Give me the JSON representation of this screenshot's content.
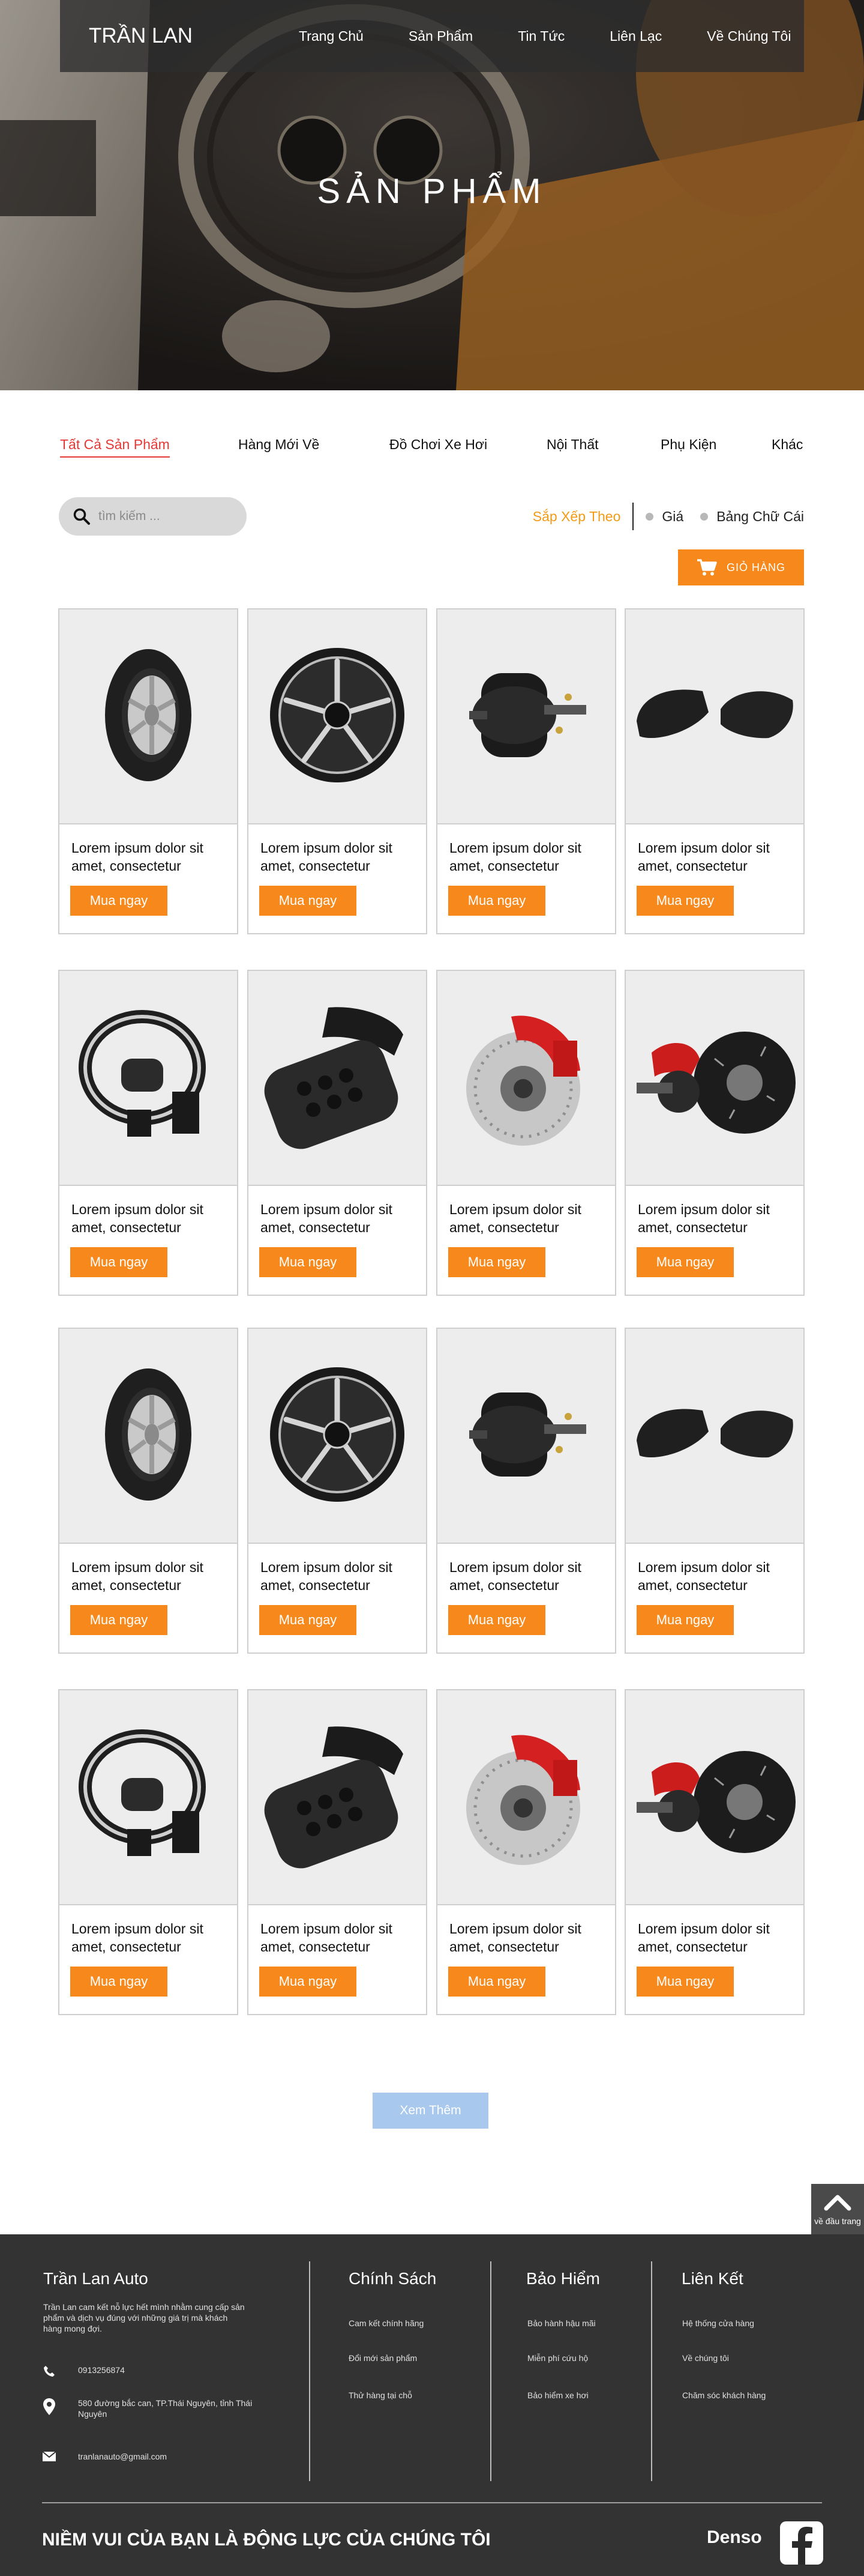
{
  "brand": "TRẦN LAN",
  "nav": [
    "Trang Chủ",
    "Sản Phẩm",
    "Tin Tức",
    "Liên Lạc",
    "Về Chúng Tôi"
  ],
  "hero_title": "SẢN PHẨM",
  "tabs": [
    "Tất Cả Sản Phẩm",
    "Hàng Mới Về",
    "Đồ Chơi Xe Hơi",
    "Nội Thất",
    "Phụ Kiện",
    "Khác"
  ],
  "search": {
    "placeholder": "tìm kiếm ..."
  },
  "sort": {
    "label": "Sắp Xếp Theo",
    "options": [
      "Giá",
      "Bảng Chữ Cái"
    ]
  },
  "cart_label": "GIỎ HÀNG",
  "buy_label": "Mua ngay",
  "product_title": "Lorem ipsum dolor sit amet, consectetur",
  "products": [
    {
      "icon": "tire-icon"
    },
    {
      "icon": "rim-icon"
    },
    {
      "icon": "brake-chamber-icon"
    },
    {
      "icon": "mirror-cover-icon"
    },
    {
      "icon": "steering-wheel-icon"
    },
    {
      "icon": "steering-remote-icon"
    },
    {
      "icon": "brake-caliper-icon"
    },
    {
      "icon": "brake-disc-icon"
    },
    {
      "icon": "tire-icon"
    },
    {
      "icon": "rim-icon"
    },
    {
      "icon": "brake-chamber-icon"
    },
    {
      "icon": "mirror-cover-icon"
    },
    {
      "icon": "steering-wheel-icon"
    },
    {
      "icon": "steering-remote-icon"
    },
    {
      "icon": "brake-caliper-icon"
    },
    {
      "icon": "brake-disc-icon"
    }
  ],
  "load_more": "Xem Thêm",
  "back_to_top": "về đầu trang",
  "footer": {
    "brand": "Trần Lan Auto",
    "description": "Trần Lan cam kết nỗ lực hết mình nhằm cung cấp sản phẩm và dịch vụ đúng với những giá trị mà khách hàng mong đợi.",
    "phone": "0913256874",
    "address": "580 đường bắc can, TP.Thái Nguyên, tỉnh Thái Nguyên",
    "email": "tranlanauto@gmail.com",
    "columns": [
      {
        "heading": "Chính Sách",
        "links": [
          "Cam kết chính hãng",
          "Đổi mới sản phẩm",
          "Thử hàng tại chỗ"
        ]
      },
      {
        "heading": "Bảo Hiểm",
        "links": [
          "Bảo hành hậu mãi",
          "Miễn phí cứu hộ",
          "Bảo hiểm xe hơi"
        ]
      },
      {
        "heading": "Liên Kết",
        "links": [
          "Hệ thống cửa hàng",
          "Về chúng tôi",
          "Chăm sóc khách hàng"
        ]
      }
    ],
    "slogan": "NIỀM VUI CỦA BẠN LÀ ĐỘNG LỰC CỦA CHÚNG TÔI",
    "partner": "Denso"
  },
  "colors": {
    "accent": "#f7891c",
    "active_tab": "#e53935",
    "sort_label": "#f39b17",
    "load_more": "#a8c8ee",
    "footer_bg": "#333333",
    "nav_bg": "#2d2d2d"
  }
}
